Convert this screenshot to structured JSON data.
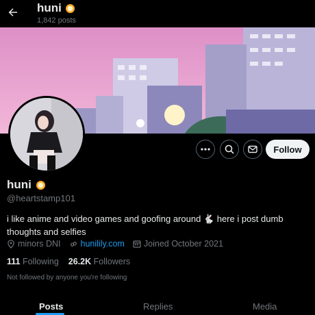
{
  "header": {
    "name": "huni",
    "post_count": "1,842 posts"
  },
  "profile": {
    "name": "huni",
    "handle": "@heartstamp101",
    "bio": "i like anime and video games and goofing around 🐇 here i post dumb thoughts and selfies",
    "location": "minors DNI",
    "website": "hunilily.com",
    "joined": "Joined October 2021",
    "following_count": "111",
    "following_label": "Following",
    "followers_count": "26.2K",
    "followers_label": "Followers",
    "not_followed_note": "Not followed by anyone you're following"
  },
  "actions": {
    "follow_label": "Follow"
  },
  "tabs": [
    {
      "label": "Posts",
      "active": true
    },
    {
      "label": "Replies",
      "active": false
    },
    {
      "label": "Media",
      "active": false
    }
  ],
  "colors": {
    "accent": "#1d9bf0",
    "background": "#000000",
    "banner_sky": "#e39ccd"
  }
}
